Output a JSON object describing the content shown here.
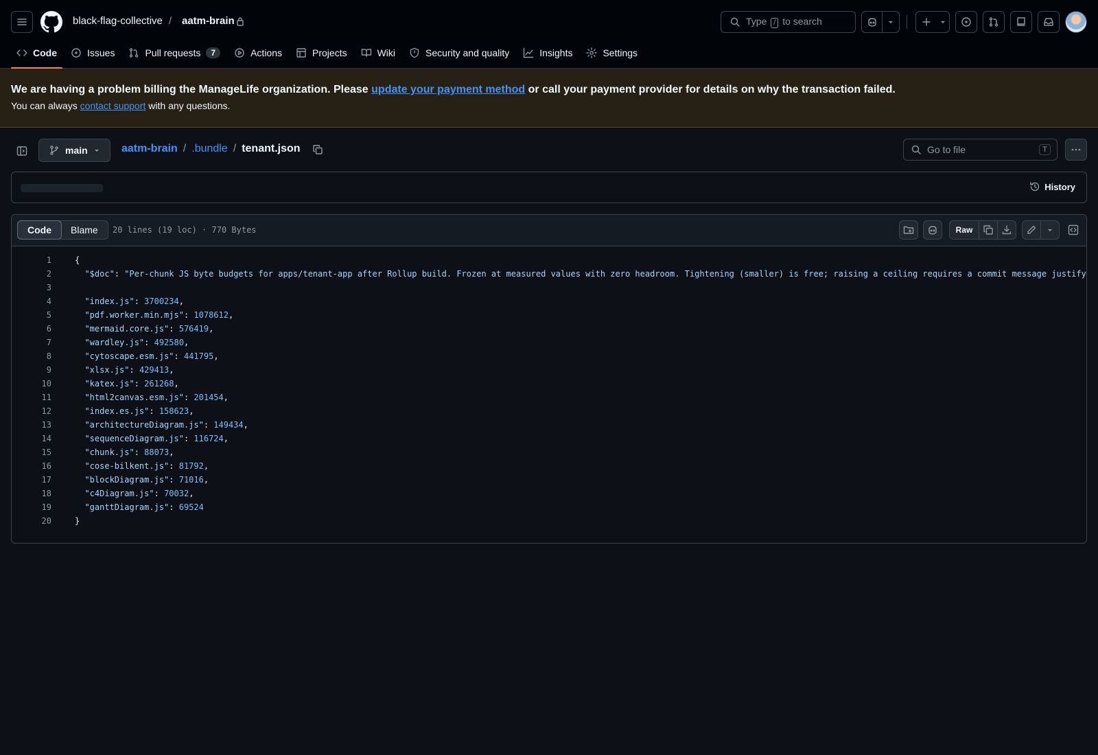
{
  "header": {
    "org": "black-flag-collective",
    "separator": "/",
    "repo": "aatm-brain",
    "search_pre": "Type",
    "search_key": "/",
    "search_post": "to search"
  },
  "tabs": [
    {
      "label": "Code",
      "selected": true
    },
    {
      "label": "Issues"
    },
    {
      "label": "Pull requests",
      "count": "7"
    },
    {
      "label": "Actions"
    },
    {
      "label": "Projects"
    },
    {
      "label": "Wiki"
    },
    {
      "label": "Security and quality"
    },
    {
      "label": "Insights"
    },
    {
      "label": "Settings"
    }
  ],
  "banner": {
    "main_pre": "We are having a problem billing the ManageLife organization. Please ",
    "main_link": "update your payment method",
    "main_post": " or call your payment provider for details on why the transaction failed.",
    "sub_pre": "You can always ",
    "sub_link": "contact support",
    "sub_post": " with any questions."
  },
  "file": {
    "branch": "main",
    "path_repo": "aatm-brain",
    "path_dir": ".bundle",
    "path_file": "tenant.json",
    "goto_placeholder": "Go to file",
    "goto_key": "T",
    "history_label": "History",
    "view_code": "Code",
    "view_blame": "Blame",
    "meta": "20 lines (19 loc) · 770 Bytes",
    "raw_label": "Raw"
  },
  "code": {
    "doc_key": "\"$doc\"",
    "doc_value": "\"Per-chunk JS byte budgets for apps/tenant-app after Rollup build. Frozen at measured values with zero headroom. Tightening (smaller) is free; raising a ceiling requires a commit message justify",
    "entries": [
      {
        "key": "\"index.js\"",
        "value": "3700234",
        "comma": ","
      },
      {
        "key": "\"pdf.worker.min.mjs\"",
        "value": "1078612",
        "comma": ","
      },
      {
        "key": "\"mermaid.core.js\"",
        "value": "576419",
        "comma": ","
      },
      {
        "key": "\"wardley.js\"",
        "value": "492580",
        "comma": ","
      },
      {
        "key": "\"cytoscape.esm.js\"",
        "value": "441795",
        "comma": ","
      },
      {
        "key": "\"xlsx.js\"",
        "value": "429413",
        "comma": ","
      },
      {
        "key": "\"katex.js\"",
        "value": "261268",
        "comma": ","
      },
      {
        "key": "\"html2canvas.esm.js\"",
        "value": "201454",
        "comma": ","
      },
      {
        "key": "\"index.es.js\"",
        "value": "158623",
        "comma": ","
      },
      {
        "key": "\"architectureDiagram.js\"",
        "value": "149434",
        "comma": ","
      },
      {
        "key": "\"sequenceDiagram.js\"",
        "value": "116724",
        "comma": ","
      },
      {
        "key": "\"chunk.js\"",
        "value": "88073",
        "comma": ","
      },
      {
        "key": "\"cose-bilkent.js\"",
        "value": "81792",
        "comma": ","
      },
      {
        "key": "\"blockDiagram.js\"",
        "value": "71016",
        "comma": ","
      },
      {
        "key": "\"c4Diagram.js\"",
        "value": "70032",
        "comma": ","
      },
      {
        "key": "\"ganttDiagram.js\"",
        "value": "69524",
        "comma": ""
      }
    ]
  },
  "colors": {
    "accent_underline": "#f78166",
    "link": "#4493f8",
    "banner_bg": "#272115",
    "string": "#a5d6ff",
    "number": "#79c0ff"
  }
}
